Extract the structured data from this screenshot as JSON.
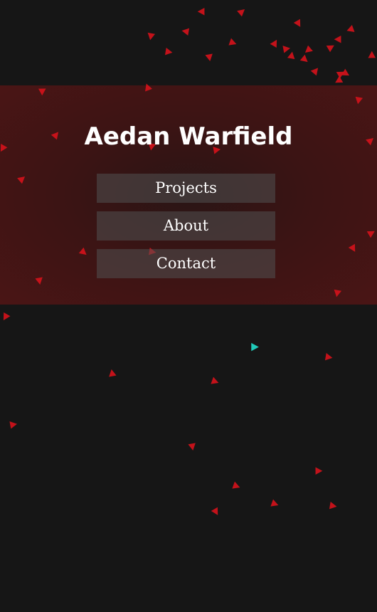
{
  "site": {
    "title": "Aedan Warfield"
  },
  "nav": {
    "items": [
      {
        "id": "projects",
        "label": "Projects"
      },
      {
        "id": "about",
        "label": "About"
      },
      {
        "id": "contact",
        "label": "Contact"
      }
    ]
  },
  "colors": {
    "background": "#161616",
    "hero_band": "#3b1414",
    "particle_red": "#d3121b",
    "particle_accent": "#20c9b8",
    "button_fill": "#4d4545",
    "text": "#ffffff"
  },
  "particles": {
    "shape": "triangle",
    "count": 58
  }
}
